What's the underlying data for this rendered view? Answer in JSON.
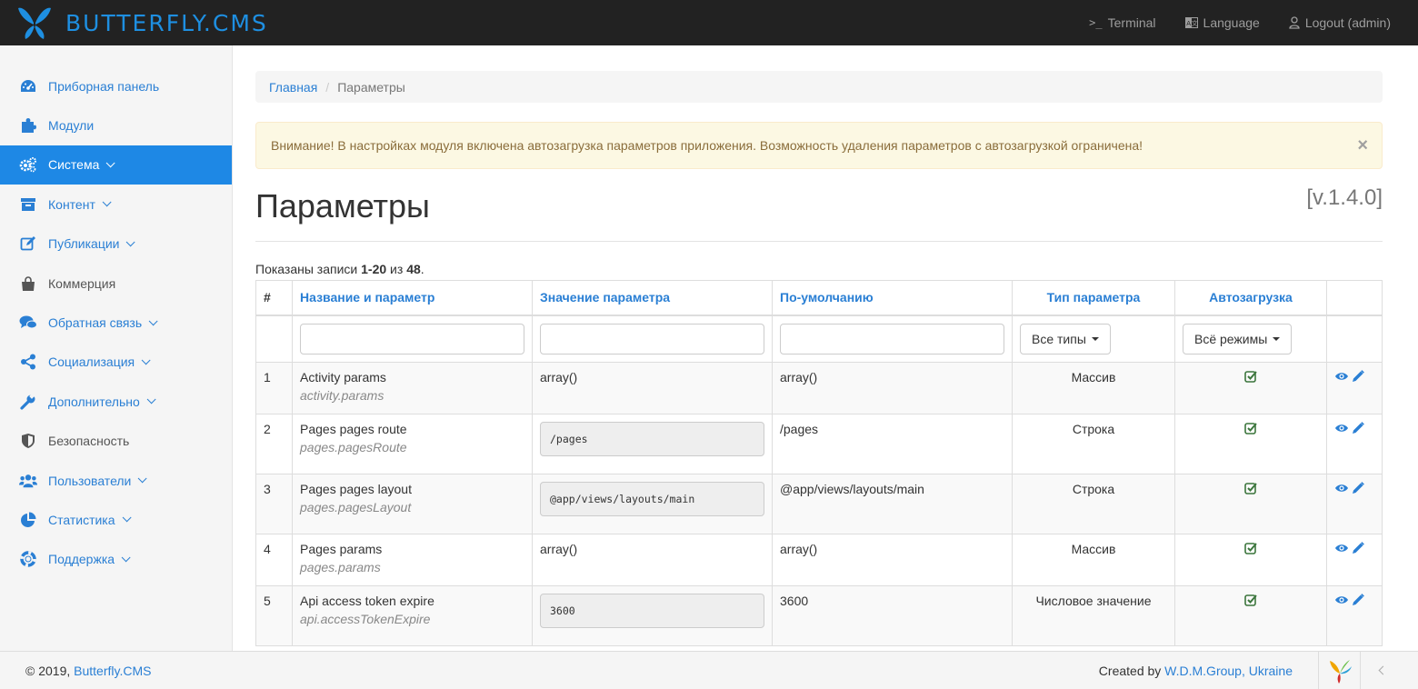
{
  "brand": {
    "name": "BUTTERFLY.CMS"
  },
  "topnav": {
    "terminal": {
      "glyph": ">_",
      "label": "Terminal"
    },
    "language": "Language",
    "logout": "Logout (admin)"
  },
  "sidebar": {
    "items": [
      {
        "label": "Приборная панель",
        "icon": "dashboard-icon"
      },
      {
        "label": "Модули",
        "icon": "puzzle-icon"
      },
      {
        "label": "Система",
        "icon": "gears-icon",
        "active": true,
        "caret": true
      },
      {
        "label": "Контент",
        "icon": "archive-icon",
        "caret": true
      },
      {
        "label": "Публикации",
        "icon": "edit-icon",
        "caret": true
      },
      {
        "label": "Коммерция",
        "icon": "shopping-bag-icon"
      },
      {
        "label": "Обратная связь",
        "icon": "comments-icon",
        "caret": true
      },
      {
        "label": "Социализация",
        "icon": "share-icon",
        "caret": true
      },
      {
        "label": "Дополнительно",
        "icon": "wrench-icon",
        "caret": true
      },
      {
        "label": "Безопасность",
        "icon": "shield-icon"
      },
      {
        "label": "Пользователи",
        "icon": "users-icon",
        "caret": true
      },
      {
        "label": "Статистика",
        "icon": "pie-chart-icon",
        "caret": true
      },
      {
        "label": "Поддержка",
        "icon": "lifebuoy-icon",
        "caret": true
      }
    ]
  },
  "breadcrumb": {
    "home": "Главная",
    "sep": "/",
    "current": "Параметры"
  },
  "alert": {
    "text": "Внимание! В настройках модуля включена автозагрузка параметров приложения. Возможность удаления параметров с автозагрузкой ограничена!",
    "close": "×"
  },
  "page": {
    "title": "Параметры",
    "version": "[v.1.4.0]"
  },
  "summary": {
    "prefix": "Показаны записи ",
    "range": "1-20",
    "middle": " из ",
    "total": "48",
    "suffix": "."
  },
  "table": {
    "headers": {
      "num": "#",
      "name": "Название и параметр",
      "value": "Значение параметра",
      "default": "По-умолчанию",
      "type": "Тип параметра",
      "autoload": "Автозагрузка"
    },
    "filters": {
      "type": "Все типы",
      "autoload": "Всё режимы"
    },
    "rows": [
      {
        "num": "1",
        "name": "Activity params",
        "key": "activity.params",
        "value": "array()",
        "value_is_field": false,
        "default": "array()",
        "type": "Массив"
      },
      {
        "num": "2",
        "name": "Pages pages route",
        "key": "pages.pagesRoute",
        "value": "/pages",
        "value_is_field": true,
        "default": "/pages",
        "type": "Строка"
      },
      {
        "num": "3",
        "name": "Pages pages layout",
        "key": "pages.pagesLayout",
        "value": "@app/views/layouts/main",
        "value_is_field": true,
        "default": "@app/views/layouts/main",
        "type": "Строка"
      },
      {
        "num": "4",
        "name": "Pages params",
        "key": "pages.params",
        "value": "array()",
        "value_is_field": false,
        "default": "array()",
        "type": "Массив"
      },
      {
        "num": "5",
        "name": "Api access token expire",
        "key": "api.accessTokenExpire",
        "value": "3600",
        "value_is_field": true,
        "default": "3600",
        "type": "Числовое значение"
      }
    ]
  },
  "footer": {
    "copy_prefix": "© 2019, ",
    "copy_link": "Butterfly.CMS",
    "created_prefix": "Created by ",
    "created_link": "W.D.M.Group, Ukraine"
  },
  "colors": {
    "accent": "#1e88e5",
    "link": "#2a7fd4",
    "navbar": "#222222",
    "check": "#3c763d"
  }
}
